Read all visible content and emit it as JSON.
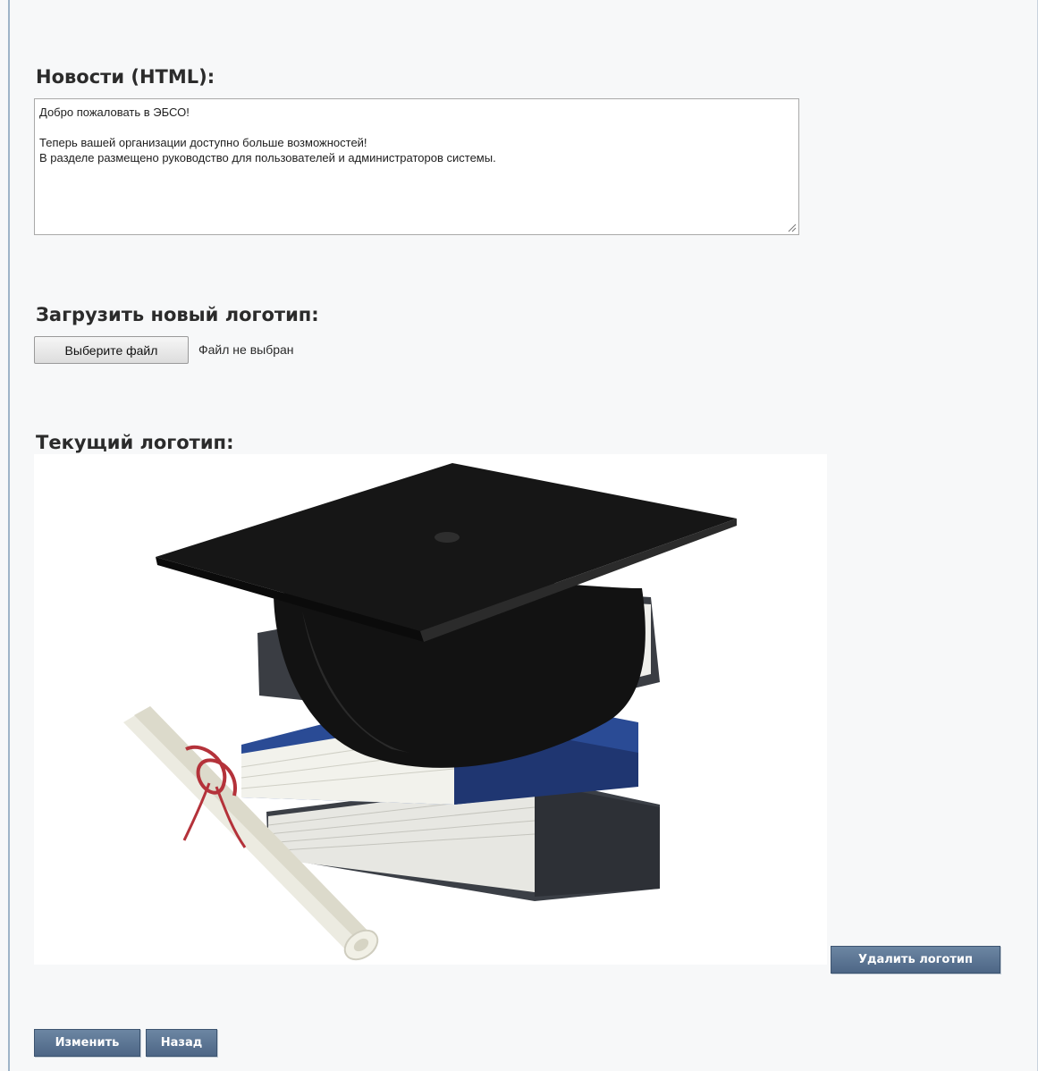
{
  "news": {
    "heading": "Новости (HTML):",
    "lines": [
      "Добро пожаловать в ЭБСО!",
      "",
      "Теперь вашей организации доступно больше возможностей!",
      "В разделе размещено руководство для пользователей и администраторов системы."
    ]
  },
  "upload": {
    "heading": "Загрузить новый логотип:",
    "choose_file_label": "Выберите файл",
    "file_status": "Файл не выбран"
  },
  "current_logo": {
    "heading": "Текущий логотип:",
    "image_icon": "graduation-cap-books-diploma-image",
    "delete_label": "Удалить логотип"
  },
  "actions": {
    "change_label": "Изменить",
    "back_label": "Назад"
  },
  "colors": {
    "button_bg": "#56708f",
    "page_bg": "#f7f8f9",
    "border_accent": "#9eb4c8"
  }
}
